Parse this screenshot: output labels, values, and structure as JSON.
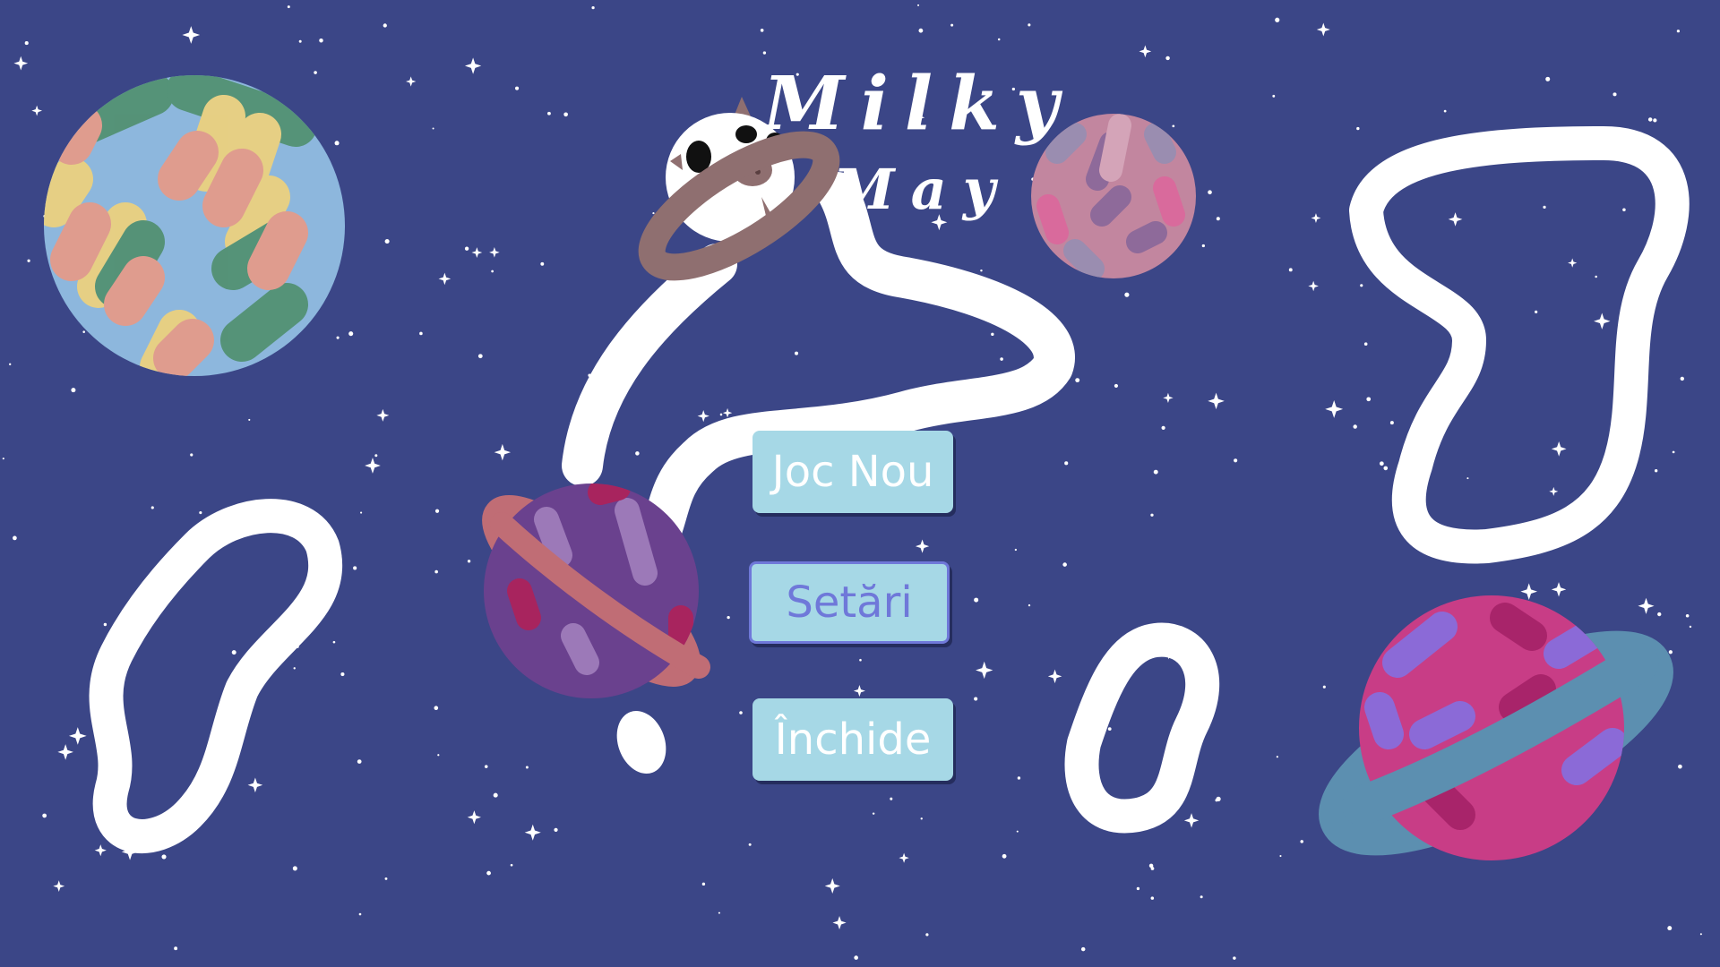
{
  "title": {
    "line1": "Milky",
    "line2": "May"
  },
  "menu": {
    "new_game": "Joc Nou",
    "settings": "Setări",
    "quit": "Închide",
    "selected": "settings"
  },
  "colors": {
    "background": "#3b4687",
    "button": "#a6d8e6",
    "button_text": "#ffffff",
    "button_selected_text": "#6f78d9"
  }
}
